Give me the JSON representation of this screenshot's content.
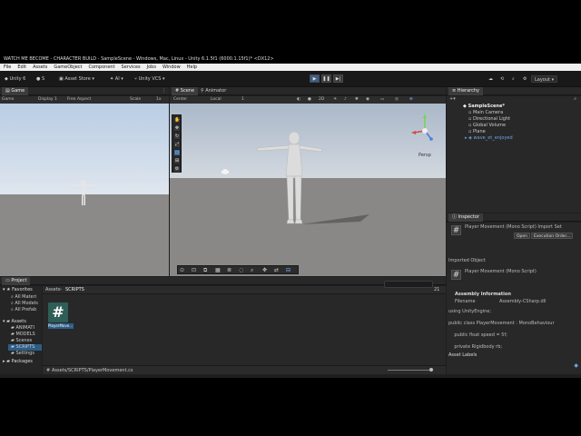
{
  "window": {
    "title": "WATCH ME BECOME - CHARACTER BUILD - SampleScene - Windows, Mac, Linux - Unity 6.1.5f1 (6000.1.15f1)* <DX12>"
  },
  "menu": [
    "File",
    "Edit",
    "Assets",
    "GameObject",
    "Component",
    "Services",
    "Jobs",
    "Window",
    "Help"
  ],
  "toolbar": {
    "unity_label": "Unity 6",
    "account": "S",
    "asset_store": "Asset Store",
    "ai": "AI",
    "vcs": "Unity VCS",
    "layout": "Layout"
  },
  "game": {
    "tab": "Game",
    "mode": "Game",
    "display": "Display 1",
    "aspect": "Free Aspect",
    "scale": "Scale",
    "scale_val": "1x"
  },
  "scene": {
    "tabs": [
      "Scene",
      "Animator"
    ],
    "pivot": "Center",
    "space": "Local",
    "step": "1",
    "gizmo_label": "Persp"
  },
  "hierarchy": {
    "tab": "Hierarchy",
    "scene": "SampleScene*",
    "items": [
      "Main Camera",
      "Directional Light",
      "Global Volume",
      "Plane",
      "wave_et_enjoyed"
    ]
  },
  "inspector": {
    "tab": "Inspector",
    "header": "Player Movement (Mono Script) Import Set",
    "open": "Open",
    "exec": "Execution Order...",
    "imported": "Imported Object",
    "script_title": "Player Movement (Mono Script)",
    "assembly_info": "Assembly Information",
    "filename_label": "Filename",
    "filename_val": "Assembly-CSharp.dll",
    "code": [
      "using UnityEngine;",
      "public class PlayerMovement : MonoBehaviour",
      "    public float speed = 5f;",
      "    private Rigidbody rb;"
    ],
    "labels": "Asset Labels"
  },
  "project": {
    "tab": "Project",
    "favorites": "Favorites",
    "fav_items": [
      "All Materi",
      "All Models",
      "All Prefab"
    ],
    "assets": "Assets",
    "asset_items": [
      "ANIMATI",
      "MODELS",
      "Scenes",
      "SCRIPTS",
      "Settings"
    ],
    "packages": "Packages",
    "breadcrumb": [
      "Assets",
      "SCRIPTS"
    ],
    "file_name": "PlayerMove...",
    "file_glyph": "#",
    "path": "Assets/SCRIPTS/PlayerMovement.cs",
    "count": "21"
  },
  "colors": {
    "accent": "#3d6fb0",
    "selected": "#2c5d87",
    "bg": "#282828"
  }
}
